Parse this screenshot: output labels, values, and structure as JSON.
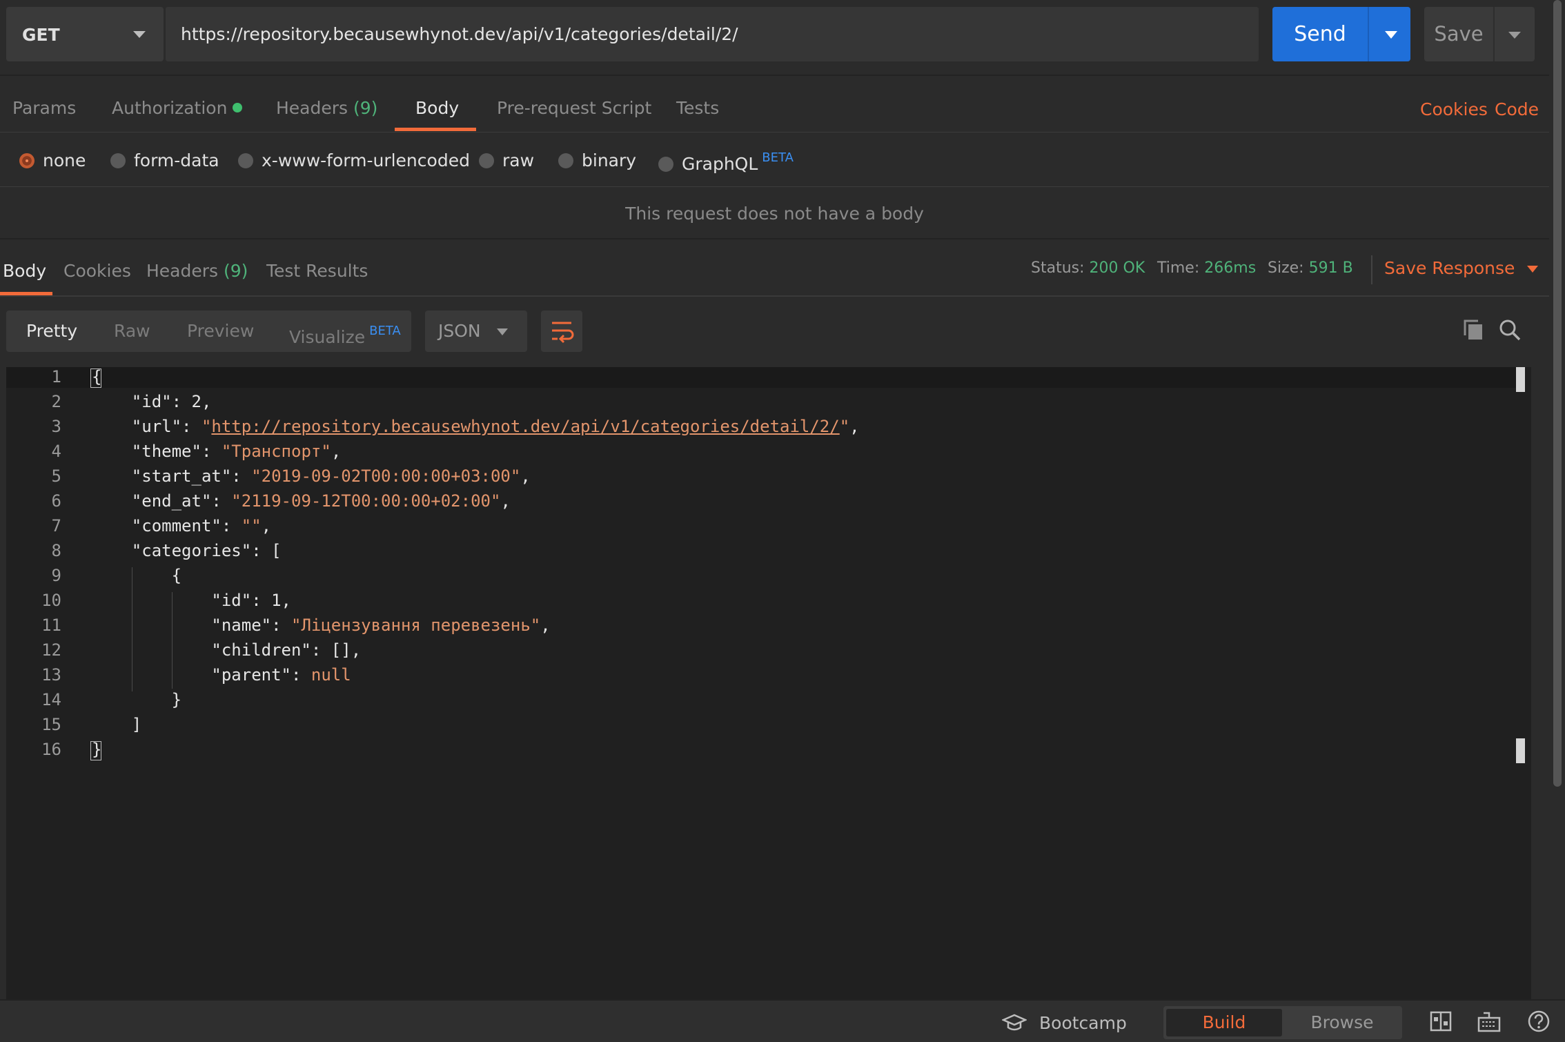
{
  "request": {
    "method": "GET",
    "url": "https://repository.becausewhynot.dev/api/v1/categories/detail/2/",
    "send_label": "Send",
    "save_label": "Save"
  },
  "request_tabs": {
    "params": "Params",
    "authorization": "Authorization",
    "headers": "Headers",
    "headers_count": "(9)",
    "body": "Body",
    "prerequest": "Pre-request Script",
    "tests": "Tests",
    "cookies_link": "Cookies",
    "code_link": "Code"
  },
  "body_types": {
    "none": "none",
    "form_data": "form-data",
    "urlencoded": "x-www-form-urlencoded",
    "raw": "raw",
    "binary": "binary",
    "graphql": "GraphQL",
    "beta": "BETA",
    "selected": "none"
  },
  "no_body_text": "This request does not have a body",
  "response_tabs": {
    "body": "Body",
    "cookies": "Cookies",
    "headers": "Headers",
    "headers_count": "(9)",
    "test_results": "Test Results"
  },
  "response_meta": {
    "status_label": "Status:",
    "status_value": "200 OK",
    "time_label": "Time:",
    "time_value": "266ms",
    "size_label": "Size:",
    "size_value": "591 B",
    "save_response": "Save Response"
  },
  "view": {
    "pretty": "Pretty",
    "raw": "Raw",
    "preview": "Preview",
    "visualize": "Visualize",
    "beta": "BETA",
    "format": "JSON"
  },
  "code": {
    "line_numbers": [
      "1",
      "2",
      "3",
      "4",
      "5",
      "6",
      "7",
      "8",
      "9",
      "10",
      "11",
      "12",
      "13",
      "14",
      "15",
      "16"
    ],
    "l1": "{",
    "l2_key": "\"id\"",
    "l2_val": "2",
    "l3_key": "\"url\"",
    "l3_val": "http://repository.becausewhynot.dev/api/v1/categories/detail/2/",
    "l4_key": "\"theme\"",
    "l4_val": "\"Транспорт\"",
    "l5_key": "\"start_at\"",
    "l5_val": "\"2019-09-02T00:00:00+03:00\"",
    "l6_key": "\"end_at\"",
    "l6_val": "\"2119-09-12T00:00:00+02:00\"",
    "l7_key": "\"comment\"",
    "l7_val": "\"\"",
    "l8_key": "\"categories\"",
    "l8_val": "[",
    "l9": "{",
    "l10_key": "\"id\"",
    "l10_val": "1",
    "l11_key": "\"name\"",
    "l11_val": "\"Ліцензування перевезень\"",
    "l12_key": "\"children\"",
    "l12_val": "[]",
    "l13_key": "\"parent\"",
    "l13_val": "null",
    "l14": "}",
    "l15": "]",
    "l16": "}"
  },
  "statusbar": {
    "bootcamp": "Bootcamp",
    "build": "Build",
    "browse": "Browse"
  },
  "colors": {
    "accent": "#f26b3a",
    "send_blue": "#1f6fd9",
    "success_green": "#4fb37a",
    "beta_blue": "#3a8ff2",
    "string_orange": "#e3956c"
  }
}
